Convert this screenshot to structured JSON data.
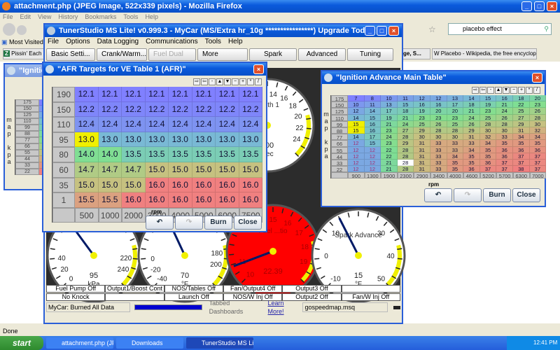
{
  "firefox": {
    "title": "attachment.php (JPEG Image, 522x339 pixels) - Mozilla Firefox",
    "menu": [
      "File",
      "Edit",
      "View",
      "History",
      "Bookmarks",
      "Tools",
      "Help"
    ],
    "search_value": "placebo effect",
    "bookmark": "Most Visited",
    "tabs": [
      "Pissin' Each Ot",
      "ge, S...",
      "Placebo - Wikipedia, the free encyclop..."
    ],
    "status": "Done"
  },
  "ts": {
    "title": "TunerStudio MS Lite! v0.999.3 - MyCar (MS/Extra hr_10g ****************) Upgrade Today!",
    "menu": [
      "File",
      "Options",
      "Data Logging",
      "Communications",
      "Tools",
      "Help"
    ],
    "toolbar": [
      "Basic Setti...",
      "Crank/Warm...",
      "Fuel Dual T...",
      "More settings",
      "Spark",
      "Advanced",
      "Tuning"
    ],
    "indicators": [
      [
        "Fuel Pump Off",
        "Output1/Boost Cont",
        "NOS/Tables Off",
        "Fan/Output4 Off",
        "Output3 Off",
        ""
      ],
      [
        "No Knock",
        "",
        "Launch Off",
        "NOS/W Inj Off",
        "Output2 Off",
        "Fan/W Inj Off"
      ]
    ],
    "status": {
      "message": "MyCar: Burned All Data",
      "progress": 1.0,
      "tabbed": "Tabbed Dashboards",
      "learn": "Learn More!",
      "file": "gospeedmap.msq"
    }
  },
  "gauges": [
    {
      "id": "map",
      "title": "",
      "value": "95",
      "unit": "kPa",
      "min": 0,
      "max": 260,
      "needle": 95,
      "labels": [
        0,
        20,
        40,
        220,
        240
      ],
      "face": "#ffffff"
    },
    {
      "id": "clt",
      "title": "",
      "value": "70",
      "unit": "°F",
      "min": -40,
      "max": 230,
      "needle": 70,
      "labels": [
        -40,
        -20,
        0,
        180,
        200
      ],
      "face": "#ffffff"
    },
    {
      "id": "afr",
      "title": "Fuel ...tio",
      "value": "22.39",
      "unit": "",
      "min": 10,
      "max": 20,
      "needle": 10.9,
      "labels": [
        10,
        11,
        15,
        16,
        17,
        18,
        19
      ],
      "face": "#ff0000"
    },
    {
      "id": "spark",
      "title": "Spark Advance",
      "value": "15",
      "unit": "°F",
      "min": -10,
      "max": 50,
      "needle": 14,
      "labels": [
        -10,
        0,
        10,
        30,
        40,
        50
      ],
      "face": "#ffffff"
    },
    {
      "id": "pw",
      "title": "Width 1",
      "value": "000",
      "unit": "Sec",
      "min": 0,
      "max": 26,
      "needle": 2,
      "labels": [
        14,
        16,
        18,
        20,
        22,
        24
      ],
      "face": "#ffffff"
    }
  ],
  "afr_window": {
    "title": "\"AFR Targets for VE Table 1 (AFR)\"",
    "xlabel": "rpm",
    "burn": "Burn",
    "close": "Close",
    "rows": [
      190,
      150,
      110,
      95,
      80,
      60,
      35,
      1
    ],
    "cols": [
      500,
      1000,
      2000,
      3000,
      4000,
      5000,
      6000,
      7500
    ],
    "values": [
      [
        "12.1",
        "12.1",
        "12.1",
        "12.1",
        "12.1",
        "12.1",
        "12.1",
        "12.1"
      ],
      [
        "12.2",
        "12.2",
        "12.2",
        "12.2",
        "12.2",
        "12.2",
        "12.2",
        "12.2"
      ],
      [
        "12.4",
        "12.4",
        "12.4",
        "12.4",
        "12.4",
        "12.4",
        "12.4",
        "12.4"
      ],
      [
        "13.0",
        "13.0",
        "13.0",
        "13.0",
        "13.0",
        "13.0",
        "13.0",
        "13.0"
      ],
      [
        "14.0",
        "14.0",
        "13.5",
        "13.5",
        "13.5",
        "13.5",
        "13.5",
        "13.5"
      ],
      [
        "14.7",
        "14.7",
        "14.7",
        "15.0",
        "15.0",
        "15.0",
        "15.0",
        "15.0"
      ],
      [
        "15.0",
        "15.0",
        "15.0",
        "16.0",
        "16.0",
        "16.0",
        "16.0",
        "16.0"
      ],
      [
        "15.5",
        "15.5",
        "16.0",
        "16.0",
        "16.0",
        "16.0",
        "16.0",
        "16.0"
      ]
    ],
    "range": [
      12.1,
      16.0
    ],
    "selected": [
      [
        3,
        0
      ]
    ]
  },
  "ign_window": {
    "title": "\"Ignition Advance Main Table\"",
    "xlabel": "rpm",
    "ylabel": "map kpa",
    "burn": "Burn",
    "close": "Close",
    "rows": [
      175,
      150,
      125,
      110,
      99,
      88,
      77,
      66,
      55,
      44,
      33,
      22
    ],
    "cols": [
      900,
      1300,
      1900,
      2300,
      2900,
      3400,
      4000,
      4600,
      5200,
      5700,
      6300,
      7000
    ],
    "values": [
      [
        7,
        8,
        10,
        11,
        12,
        12,
        13,
        14,
        15,
        16,
        18,
        20
      ],
      [
        10,
        11,
        13,
        15,
        16,
        16,
        17,
        18,
        19,
        21,
        22,
        23
      ],
      [
        12,
        14,
        17,
        18,
        19,
        20,
        20,
        21,
        23,
        24,
        25,
        26
      ],
      [
        14,
        15,
        19,
        21,
        23,
        23,
        23,
        24,
        25,
        26,
        27,
        28
      ],
      [
        15,
        16,
        21,
        24,
        25,
        26,
        25,
        26,
        28,
        28,
        29,
        30
      ],
      [
        15,
        16,
        23,
        27,
        29,
        28,
        28,
        29,
        30,
        30,
        31,
        32
      ],
      [
        14,
        17,
        24,
        28,
        30,
        30,
        30,
        31,
        32,
        33,
        34,
        34
      ],
      [
        12,
        15,
        23,
        29,
        31,
        33,
        33,
        33,
        34,
        35,
        35,
        35
      ],
      [
        12,
        12,
        22,
        28,
        31,
        33,
        33,
        34,
        35,
        36,
        36,
        36
      ],
      [
        12,
        12,
        22,
        28,
        31,
        33,
        34,
        35,
        35,
        36,
        37,
        37
      ],
      [
        12,
        12,
        21,
        28,
        31,
        33,
        35,
        35,
        36,
        37,
        37,
        37
      ],
      [
        12,
        12,
        21,
        28,
        31,
        33,
        35,
        36,
        37,
        37,
        38,
        37
      ]
    ],
    "range": [
      7,
      38
    ],
    "selected": [
      [
        4,
        0
      ],
      [
        5,
        0
      ]
    ],
    "editing": [
      [
        10,
        3
      ]
    ]
  },
  "bg_window": {
    "title": "\"Ignition A",
    "ylabel": "map kpa",
    "rows": [
      175,
      150,
      125,
      110,
      99,
      88,
      77,
      66,
      55,
      44,
      33,
      22
    ]
  },
  "taskbar": {
    "start": "start",
    "tasks": [
      "attachment.php (JPE...",
      "Downloads",
      "TunerStudio MS Lite! ..."
    ],
    "clock": "12:41 PM"
  },
  "colors": {
    "cold": "#8080ff",
    "mid": "#80e090",
    "warm": "#c8c080",
    "hot": "#f08080",
    "selected": "#f0f000"
  }
}
